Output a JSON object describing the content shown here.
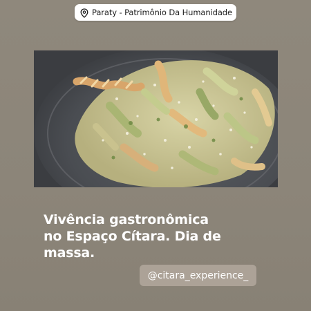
{
  "location_sticker": {
    "icon": "map-pin-icon",
    "text": "Paraty - Patrimônio Da Humanidade"
  },
  "photo": {
    "subject": "food-photo"
  },
  "caption": {
    "text": "Vivência gastronômica\nno Espaço Cítara. Dia de\nmassa."
  },
  "mention_sticker": {
    "text": "@citara_experience_"
  },
  "colors": {
    "background": "#8e877b",
    "sticker_bg": "#ffffff",
    "caption_text": "#ffffff"
  }
}
